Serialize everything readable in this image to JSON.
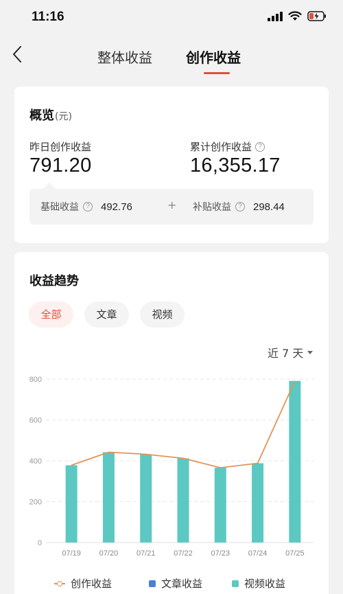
{
  "status_bar": {
    "time": "11:16"
  },
  "nav": {
    "tabs": [
      {
        "label": "整体收益",
        "active": false
      },
      {
        "label": "创作收益",
        "active": true
      }
    ]
  },
  "overview": {
    "title": "概览",
    "unit": "(元)",
    "yesterday_label": "昨日创作收益",
    "yesterday_value": "791.20",
    "total_label": "累计创作收益",
    "total_value": "16,355.17",
    "base_label": "基础收益",
    "base_value": "492.76",
    "plus": "+",
    "subsidy_label": "补贴收益",
    "subsidy_value": "298.44"
  },
  "trend": {
    "title": "收益趋势",
    "filters": [
      {
        "label": "全部",
        "active": true
      },
      {
        "label": "文章",
        "active": false
      },
      {
        "label": "视频",
        "active": false
      }
    ],
    "range_label": "近 7 天"
  },
  "chart_data": {
    "type": "bar",
    "categories": [
      "07/19",
      "07/20",
      "07/21",
      "07/22",
      "07/23",
      "07/24",
      "07/25"
    ],
    "series": [
      {
        "name": "创作收益",
        "type": "line",
        "color": "#e39458",
        "values": [
          378,
          442,
          432,
          412,
          366,
          388,
          791
        ]
      },
      {
        "name": "文章收益",
        "type": "bar",
        "color": "#4a7fd4",
        "values": [
          0,
          0,
          0,
          0,
          0,
          0,
          0
        ]
      },
      {
        "name": "视频收益",
        "type": "bar",
        "color": "#5cc8c2",
        "values": [
          378,
          442,
          432,
          412,
          366,
          388,
          791
        ]
      }
    ],
    "yticks": [
      0,
      200,
      400,
      600,
      800
    ],
    "ylim": [
      0,
      800
    ],
    "grid": true,
    "legend_position": "bottom"
  }
}
